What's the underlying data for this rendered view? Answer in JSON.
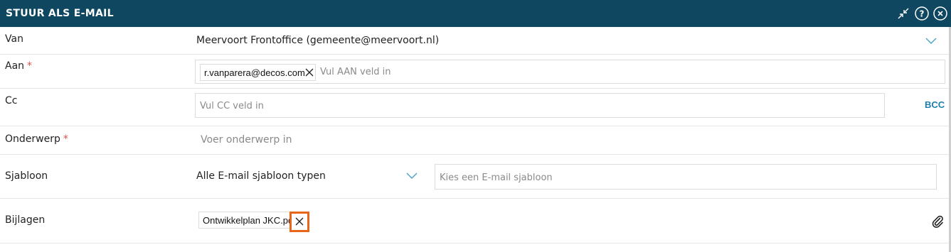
{
  "window": {
    "title": "STUUR ALS E-MAIL",
    "actions": [
      "collapse-icon",
      "help-icon",
      "close-icon"
    ]
  },
  "form": {
    "van": {
      "label": "Van",
      "value": "Meervoort Frontoffice (gemeente@meervoort.nl)"
    },
    "aan": {
      "label": "Aan",
      "required_mark": "*",
      "recipients": [
        "r.vanparera@decos.com"
      ],
      "placeholder": "Vul AAN veld in"
    },
    "cc": {
      "label": "Cc",
      "placeholder": "Vul CC veld in",
      "bcc_link": "BCC"
    },
    "onderwerp": {
      "label": "Onderwerp",
      "required_mark": "*",
      "placeholder": "Voer onderwerp in"
    },
    "sjabloon": {
      "label": "Sjabloon",
      "type_value": "Alle E-mail sjabloon typen",
      "template_placeholder": "Kies een E-mail sjabloon"
    },
    "bijlagen": {
      "label": "Bijlagen",
      "attachments": [
        "Ontwikkelplan JKC.pdf"
      ]
    }
  },
  "colors": {
    "titlebar": "#0f4660",
    "accent": "#1d7fae",
    "required": "#d9534f",
    "highlight": "#e8651a"
  }
}
